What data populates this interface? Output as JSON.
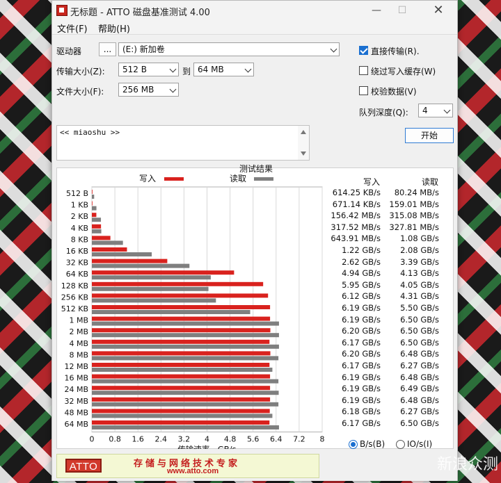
{
  "window": {
    "title": "无标题 - ATTO 磁盘基准测试 4.00",
    "min": "—",
    "max": "☐",
    "close": "✕"
  },
  "menu": {
    "file": "文件(F)",
    "help": "帮助(H)"
  },
  "form": {
    "drive_label": "驱动器",
    "browse_label": "...",
    "drive_value": "(E:) 新加卷",
    "transfer_label": "传输大小(Z):",
    "transfer_from": "512 B",
    "to_label": "到",
    "transfer_to": "64 MB",
    "filesize_label": "文件大小(F):",
    "filesize_value": "256 MB",
    "direct_io_label": "直接传输(R).",
    "direct_io_checked": true,
    "bypass_cache_label": "绕过写入缓存(W)",
    "bypass_cache_checked": false,
    "verify_label": "校验数据(V)",
    "verify_checked": false,
    "queue_label": "队列深度(Q):",
    "queue_value": "4",
    "start_label": "开始",
    "memo_text": "<< miaoshu >>"
  },
  "results": {
    "title": "测试结果",
    "write_label": "写入",
    "read_label": "读取",
    "col_write": "写入",
    "col_read": "读取",
    "write_values": [
      "614.25 KB/s",
      "671.14 KB/s",
      "156.42 MB/s",
      "317.52 MB/s",
      "643.91 MB/s",
      "1.22 GB/s",
      "2.62 GB/s",
      "4.94 GB/s",
      "5.95 GB/s",
      "6.12 GB/s",
      "6.19 GB/s",
      "6.19 GB/s",
      "6.20 GB/s",
      "6.17 GB/s",
      "6.20 GB/s",
      "6.17 GB/s",
      "6.19 GB/s",
      "6.19 GB/s",
      "6.19 GB/s",
      "6.18 GB/s",
      "6.17 GB/s"
    ],
    "read_values": [
      "80.24 MB/s",
      "159.01 MB/s",
      "315.08 MB/s",
      "327.81 MB/s",
      "1.08 GB/s",
      "2.08 GB/s",
      "3.39 GB/s",
      "4.13 GB/s",
      "4.05 GB/s",
      "4.31 GB/s",
      "5.50 GB/s",
      "6.50 GB/s",
      "6.50 GB/s",
      "6.50 GB/s",
      "6.48 GB/s",
      "6.27 GB/s",
      "6.48 GB/s",
      "6.49 GB/s",
      "6.48 GB/s",
      "6.27 GB/s",
      "6.50 GB/s"
    ],
    "unit_bs": "B/s(B)",
    "unit_ios": "IO/s(I)",
    "unit_bs_selected": true
  },
  "chart_data": {
    "type": "bar",
    "orientation": "horizontal",
    "categories": [
      "512 B",
      "1 KB",
      "2 KB",
      "4 KB",
      "8 KB",
      "16 KB",
      "32 KB",
      "64 KB",
      "128 KB",
      "256 KB",
      "512 KB",
      "1 MB",
      "2 MB",
      "4 MB",
      "8 MB",
      "12 MB",
      "16 MB",
      "24 MB",
      "32 MB",
      "48 MB",
      "64 MB"
    ],
    "series": [
      {
        "name": "写入",
        "color": "#d9221e",
        "values": [
          0.0006,
          0.0007,
          0.156,
          0.318,
          0.644,
          1.22,
          2.62,
          4.94,
          5.95,
          6.12,
          6.19,
          6.19,
          6.2,
          6.17,
          6.2,
          6.17,
          6.19,
          6.19,
          6.19,
          6.18,
          6.17
        ]
      },
      {
        "name": "读取",
        "color": "#7f7f7f",
        "values": [
          0.08,
          0.159,
          0.315,
          0.328,
          1.08,
          2.08,
          3.39,
          4.13,
          4.05,
          4.31,
          5.5,
          6.5,
          6.5,
          6.5,
          6.48,
          6.27,
          6.48,
          6.49,
          6.48,
          6.27,
          6.5
        ]
      }
    ],
    "xlim": [
      0,
      8
    ],
    "xticks": [
      "0",
      "0.8",
      "1.6",
      "2.4",
      "3.2",
      "4",
      "4.8",
      "5.6",
      "6.4",
      "7.2",
      "8"
    ],
    "xlabel": "传输速率 - GB/s",
    "grid": true
  },
  "banner": {
    "logo": "ATTO",
    "slogan": "存储与网络技术专家",
    "url": "www.atto.com"
  },
  "watermark": "新浪众测"
}
